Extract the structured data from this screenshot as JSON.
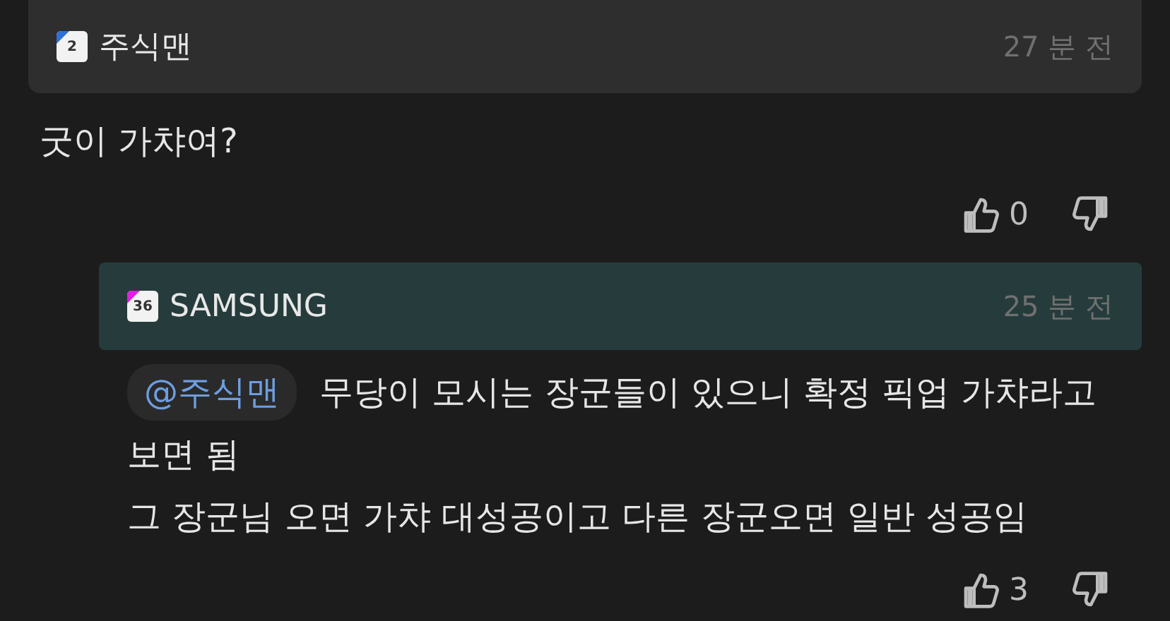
{
  "comments": [
    {
      "author": "주식맨",
      "badge": {
        "level": "2",
        "color": "#2f6fd6"
      },
      "time": "27 분 전",
      "paragraphs": [
        {
          "text": "굿이 가챠여?"
        }
      ],
      "likes": "0",
      "children": [
        {
          "author": "SAMSUNG",
          "badge": {
            "level": "36",
            "color": "#e01ee8"
          },
          "time": "25 분 전",
          "mention": "@주식맨",
          "paragraphs": [
            {
              "text": "무당이 모시는 장군들이 있으니 확정 픽업 가챠라고 보면 됨"
            },
            {
              "text": "그 장군님 오면 가챠 대성공이고 다른 장군오면 일반 성공임"
            }
          ],
          "likes": "3"
        }
      ]
    }
  ]
}
